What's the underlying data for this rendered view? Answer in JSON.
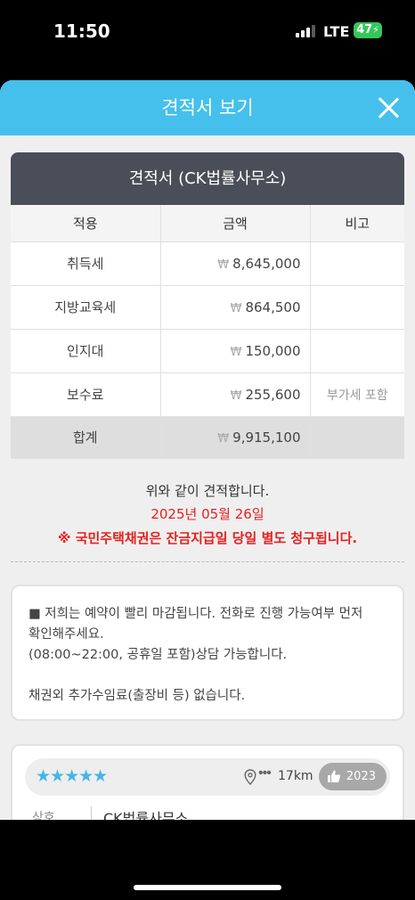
{
  "status_bar": {
    "time": "11:50",
    "network": "LTE",
    "battery": "47",
    "battery_color": "#34c759"
  },
  "header": {
    "title": "견적서 보기",
    "close_icon": "close-icon",
    "color": "#45c0ec"
  },
  "quote": {
    "title": "견적서 (CK법률사무소)",
    "columns": [
      "적용",
      "금액",
      "비고"
    ],
    "currency": "₩",
    "rows": [
      {
        "name": "취득세",
        "amount": "8,645,000",
        "note": ""
      },
      {
        "name": "지방교육세",
        "amount": "864,500",
        "note": ""
      },
      {
        "name": "인지대",
        "amount": "150,000",
        "note": ""
      },
      {
        "name": "보수료",
        "amount": "255,600",
        "note": "부가세 포함"
      }
    ],
    "total": {
      "name": "합계",
      "amount": "9,915,100",
      "note": ""
    }
  },
  "messages": {
    "line1": "위와 같이 견적합니다.",
    "date": "2025년 05월 26일",
    "bond_notice": "※ 국민주택채권은 잔금지급일 당일 별도 청구됩니다."
  },
  "notice": {
    "line1": "■ 저희는 예약이 빨리 마감됩니다.  전화로 진행 가능여부 먼저",
    "line2": "확인해주세요.",
    "line3": "(08:00~22:00, 공휴일 포함)상담 가능합니다.",
    "line4": "",
    "line5": "채권외 추가수임료(출장비 등) 없습니다."
  },
  "office_card": {
    "rating": 5,
    "stars": "★★★★★",
    "location_icon": "map-pin-icon",
    "dots": "•••",
    "distance": "17km",
    "year_icon": "thumbs-up-icon",
    "year": "2023",
    "label_name": "상호",
    "office_name": "CK법률사무소"
  }
}
